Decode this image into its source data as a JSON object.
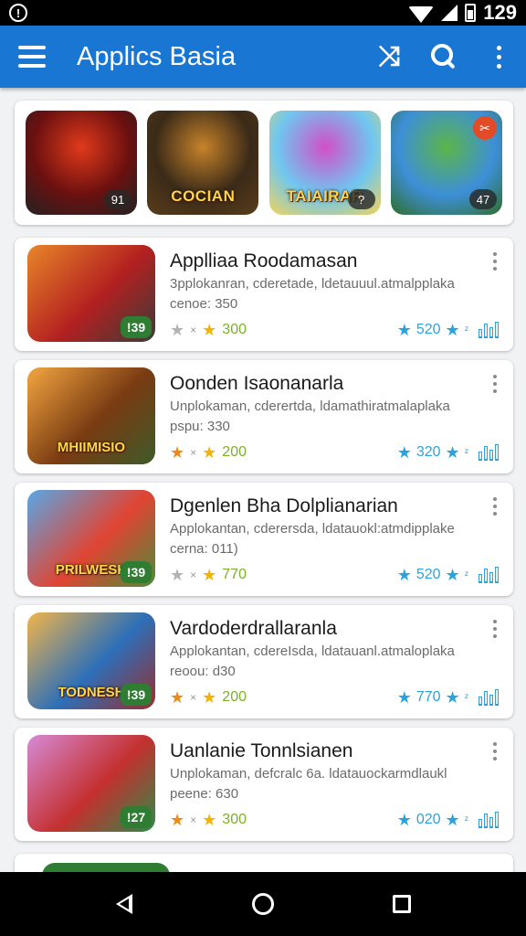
{
  "status_bar": {
    "alert_icon": "alert-circle-icon",
    "time": "129",
    "icons": [
      "wifi-icon",
      "signal-icon",
      "battery-icon"
    ]
  },
  "app_bar": {
    "title": "Applics Basia",
    "color": "#1976d2",
    "actions": [
      "shuffle-icon",
      "search-icon",
      "more-vert-icon"
    ]
  },
  "featured": [
    {
      "label": "",
      "badge": "91",
      "corner": "",
      "colors": [
        "#6b1010",
        "#e03a1a",
        "#222"
      ]
    },
    {
      "label": "COCIAN",
      "badge": "",
      "corner": "",
      "colors": [
        "#3a2a18",
        "#c7832a",
        "#5a3d1a"
      ]
    },
    {
      "label": "TAIAIRAR",
      "badge": "?",
      "corner": "",
      "colors": [
        "#6fc7f0",
        "#d24fc8",
        "#f2d35a"
      ]
    },
    {
      "label": "",
      "badge": "47",
      "corner": "✂",
      "colors": [
        "#3d8fd8",
        "#5cb548",
        "#2f6e2a"
      ]
    }
  ],
  "apps": [
    {
      "name": "Applliaa Roodamasan",
      "description": "3pplokanran, cderetade, ldetauuul.atmalpplaka",
      "meta": "cenoe: 350",
      "thumb_badge": "!39",
      "thumb_label": "",
      "thumb_colors": [
        "#e8862a",
        "#b32020",
        "#3b3b3b"
      ],
      "first_star": "grey",
      "rating": "300",
      "stat": "520"
    },
    {
      "name": "Oonden Isaonanarla",
      "description": "Unplokaman, cderertda, ldamathiratmalaplaka",
      "meta": "pspu: 330",
      "thumb_badge": "",
      "thumb_label": "MHIIMISIO",
      "thumb_colors": [
        "#f3a640",
        "#7a3b12",
        "#3d5a2a"
      ],
      "first_star": "orange",
      "rating": "200",
      "stat": "320"
    },
    {
      "name": "Dgenlen Bha Dolplianarian",
      "description": "Applokantan, cderersda, ldatauokl:atmdipplake",
      "meta": "cerna: 011)",
      "thumb_badge": "!39",
      "thumb_label": "PRILWESK",
      "thumb_colors": [
        "#58a8e6",
        "#e04432",
        "#4c8c3a"
      ],
      "first_star": "grey",
      "rating": "770",
      "stat": "520"
    },
    {
      "name": "Vardoderdrallaranla",
      "description": "Applokantan, cdereIsda, ldatauanl.atmaloplaka",
      "meta": "reoou: d30",
      "thumb_badge": "!39",
      "thumb_label": "TODNESH",
      "thumb_colors": [
        "#f2b54a",
        "#2c6fb8",
        "#9a2d2d"
      ],
      "first_star": "orange",
      "rating": "200",
      "stat": "770"
    },
    {
      "name": "Uanlanie Tonnlsianen",
      "description": "Unplokaman, defcralc 6a. ldatauockarmdlaukl",
      "meta": "peene: 630",
      "thumb_badge": "!27",
      "thumb_label": "",
      "thumb_colors": [
        "#d68ad6",
        "#c4302e",
        "#2e8a4a"
      ],
      "first_star": "orange",
      "rating": "300",
      "stat": "020"
    }
  ],
  "nav_bar": {
    "buttons": [
      "back-icon",
      "home-icon",
      "recents-icon"
    ]
  }
}
